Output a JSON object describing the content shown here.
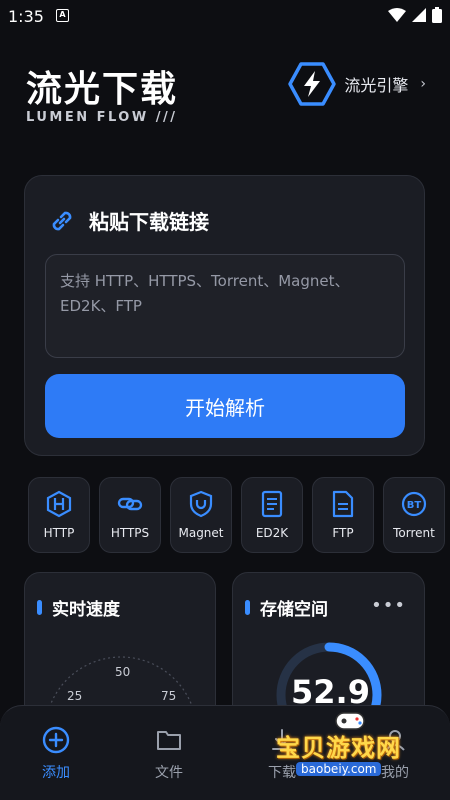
{
  "status": {
    "time": "1:35",
    "notif_letter": "A"
  },
  "header": {
    "title": "流光下载",
    "subtitle": "LUMEN FLOW  ///",
    "engine_label": "流光引擎",
    "engine_chevron": "›"
  },
  "paste": {
    "title": "粘贴下载链接",
    "placeholder": "支持 HTTP、HTTPS、Torrent、Magnet、ED2K、FTP",
    "parse_label": "开始解析"
  },
  "protocols": [
    {
      "label": "HTTP",
      "icon": "http-hex-icon"
    },
    {
      "label": "HTTPS",
      "icon": "link-secure-icon"
    },
    {
      "label": "Magnet",
      "icon": "magnet-shield-icon"
    },
    {
      "label": "ED2K",
      "icon": "document-icon"
    },
    {
      "label": "FTP",
      "icon": "file-icon"
    },
    {
      "label": "Torrent",
      "icon": "bt-badge-icon"
    }
  ],
  "speed": {
    "title": "实时速度",
    "ticks": [
      "50",
      "25",
      "75"
    ]
  },
  "storage": {
    "title": "存储空间",
    "more": "•••",
    "value": "52.9",
    "usage_fraction": 0.33
  },
  "nav": {
    "add": "添加",
    "files": "文件",
    "downloads": "下载",
    "mine": "我的"
  },
  "watermark": {
    "title": "宝贝游戏网",
    "url": "baobeiy.com"
  },
  "colors": {
    "accent": "#2e7bf6",
    "icon_blue": "#3a8dff",
    "card_bg": "#1b1d24",
    "page_bg": "#0d0e12"
  }
}
